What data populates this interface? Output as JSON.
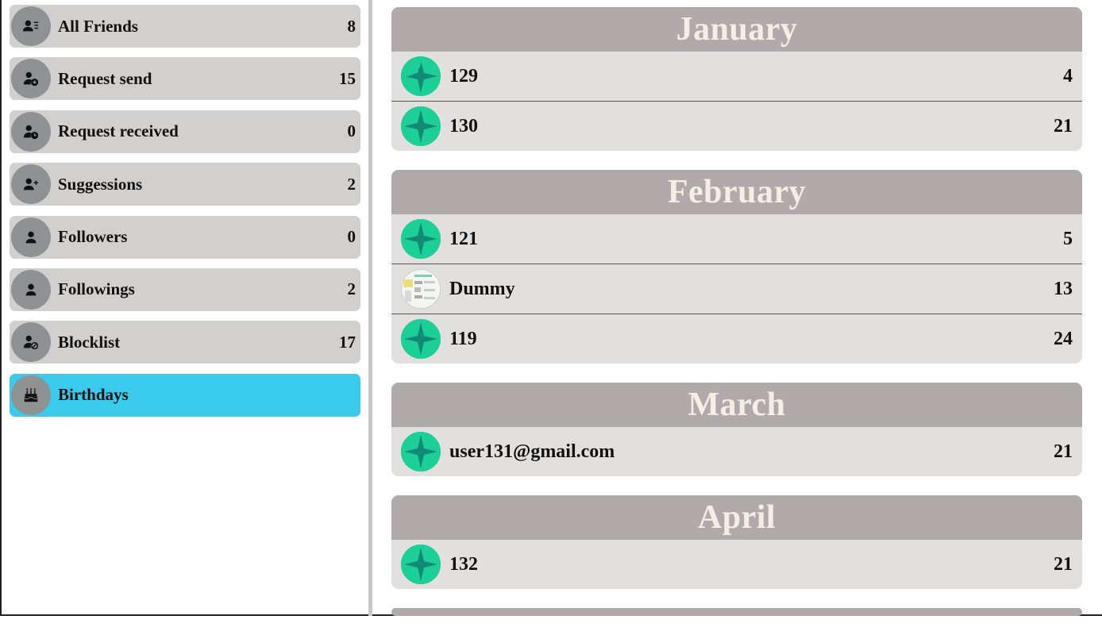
{
  "sidebar": {
    "items": [
      {
        "label": "All Friends",
        "count": "8",
        "icon": "friends-list-icon",
        "active": false
      },
      {
        "label": "Request send",
        "count": "15",
        "icon": "person-add-circle-icon",
        "active": false
      },
      {
        "label": "Request received",
        "count": "0",
        "icon": "person-clock-icon",
        "active": false
      },
      {
        "label": "Suggessions",
        "count": "2",
        "icon": "person-plus-icon",
        "active": false
      },
      {
        "label": "Followers",
        "count": "0",
        "icon": "person-icon",
        "active": false
      },
      {
        "label": "Followings",
        "count": "2",
        "icon": "person-icon",
        "active": false
      },
      {
        "label": "Blocklist",
        "count": "17",
        "icon": "person-block-icon",
        "active": false
      },
      {
        "label": "Birthdays",
        "count": "",
        "icon": "birthday-cake-icon",
        "active": true
      }
    ]
  },
  "months": [
    {
      "name": "January",
      "entries": [
        {
          "name": "129",
          "day": "4",
          "avatar": "pattern"
        },
        {
          "name": "130",
          "day": "21",
          "avatar": "pattern"
        }
      ]
    },
    {
      "name": "February",
      "entries": [
        {
          "name": "121",
          "day": "5",
          "avatar": "pattern"
        },
        {
          "name": "Dummy",
          "day": "13",
          "avatar": "photo"
        },
        {
          "name": "119",
          "day": "24",
          "avatar": "pattern"
        }
      ]
    },
    {
      "name": "March",
      "entries": [
        {
          "name": "user131@gmail.com",
          "day": "21",
          "avatar": "pattern"
        }
      ]
    },
    {
      "name": "April",
      "entries": [
        {
          "name": "132",
          "day": "21",
          "avatar": "pattern"
        }
      ]
    }
  ],
  "colors": {
    "active": "#3acbec",
    "item_bg": "#d1d0ce",
    "month_header": "#b0aaaa",
    "month_text": "#f4efe6",
    "avatar": "#1ccf97"
  }
}
